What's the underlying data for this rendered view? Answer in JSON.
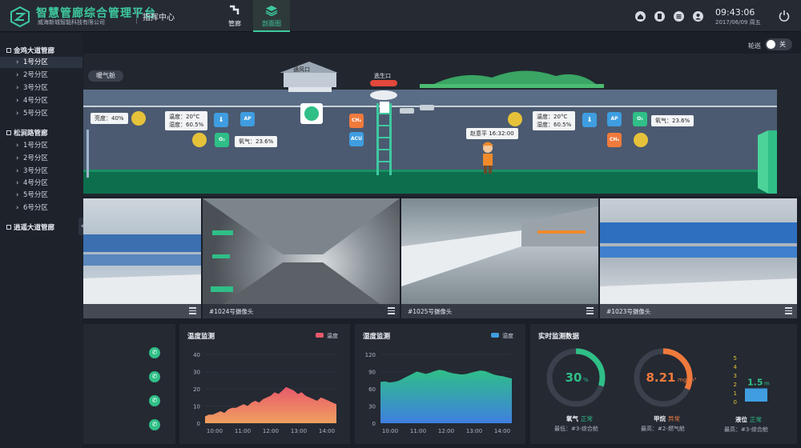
{
  "header": {
    "brand_title": "智慧管廊综合管理平台",
    "brand_subtitle": "威海新城智能科技有限公司",
    "center_label": "指挥中心",
    "nav_tabs": [
      {
        "label": "管廊",
        "icon": "pipe-icon",
        "active": false
      },
      {
        "label": "剖面图",
        "icon": "layers-icon",
        "active": true
      }
    ],
    "icons": [
      "home-icon",
      "document-icon",
      "list-icon",
      "user-icon"
    ],
    "time": "09:43:06",
    "date": "2017/06/09 周五",
    "power_icon": "power-icon"
  },
  "sidebar": {
    "groups": [
      {
        "label": "金鸡大道管廊",
        "items": [
          "1号分区",
          "2号分区",
          "3号分区",
          "4号分区",
          "5号分区"
        ]
      },
      {
        "label": "松涧路管廊",
        "items": [
          "1号分区",
          "2号分区",
          "3号分区",
          "4号分区",
          "5号分区",
          "6号分区"
        ]
      },
      {
        "label": "逍遥大道管廊",
        "items": []
      }
    ],
    "active_item": "1号分区",
    "collapse_glyph": "«"
  },
  "toolbar": {
    "patrol_label": "轮巡",
    "patrol_toggle_state": "关"
  },
  "scene": {
    "room_button": "暖气舱",
    "vent_label": "通风口",
    "escape_label": "逃生口",
    "brightness_tag": "亮度：40%",
    "left_temp": "温度：20°C",
    "left_humidity": "湿度：60.5%",
    "left_oxygen": "氧气：23.6%",
    "right_temp": "温度：20°C",
    "right_humidity": "湿度：60.5%",
    "right_oxygen": "氧气：23.6%",
    "person_tag": "赵意平 16:32:00",
    "sensor_ap": "AP",
    "sensor_ch4": "CH₄",
    "sensor_acu": "ACU",
    "sensor_o2": "O₂"
  },
  "cameras": [
    {
      "label": ""
    },
    {
      "label": "#1024号摄像头"
    },
    {
      "label": "#1025号摄像头"
    },
    {
      "label": "#1023号摄像头"
    }
  ],
  "temp_chart": {
    "title": "温度监测",
    "legend": "温度",
    "color": "#e8596a",
    "y_ticks": [
      "40",
      "30",
      "20",
      "10",
      "0"
    ],
    "x_ticks": [
      "10:00",
      "11:00",
      "12:00",
      "13:00",
      "14:00"
    ]
  },
  "humidity_chart": {
    "title": "湿度监测",
    "legend": "湿度",
    "color": "#3f9de0",
    "y_ticks": [
      "120",
      "90",
      "60",
      "30",
      "0"
    ],
    "x_ticks": [
      "10:00",
      "11:00",
      "12:00",
      "13:00",
      "14:00"
    ]
  },
  "chart_data": [
    {
      "type": "area",
      "title": "温度监测",
      "series": [
        {
          "name": "温度",
          "values": [
            4,
            5,
            5,
            6,
            7,
            6,
            8,
            9,
            9,
            10,
            11,
            10,
            12,
            13,
            12,
            14,
            15,
            16,
            18,
            17,
            19,
            21,
            20,
            19,
            17,
            18,
            16,
            15,
            14,
            13,
            15,
            14,
            13,
            12,
            11
          ]
        }
      ],
      "x": [
        "09:30",
        "14:45"
      ],
      "x_ticks": [
        "10:00",
        "11:00",
        "12:00",
        "13:00",
        "14:00"
      ],
      "ylim": [
        0,
        40
      ]
    },
    {
      "type": "area",
      "title": "湿度监测",
      "series": [
        {
          "name": "湿度",
          "values": [
            72,
            73,
            71,
            72,
            74,
            78,
            82,
            86,
            90,
            88,
            86,
            88,
            91,
            93,
            92,
            89,
            87,
            86,
            85,
            86,
            88,
            90,
            92,
            91,
            88,
            85,
            83,
            82,
            80,
            78
          ]
        }
      ],
      "x": [
        "09:30",
        "14:45"
      ],
      "x_ticks": [
        "10:00",
        "11:00",
        "12:00",
        "13:00",
        "14:00"
      ],
      "ylim": [
        0,
        120
      ]
    }
  ],
  "realtime": {
    "title": "实时监测数据",
    "oxygen": {
      "value": "30",
      "unit": "%",
      "fraction": 0.3,
      "name": "氧气",
      "status": "正常",
      "sub": "最低：#3-综合舱",
      "color": "#2fbf87"
    },
    "methane": {
      "value": "8.21",
      "unit": "mg/m³",
      "fraction": 0.32,
      "name": "甲烷",
      "status": "异常",
      "sub": "最高：#2-燃气舱",
      "color": "#f07a3c"
    },
    "level": {
      "value": "1.5",
      "unit": "m",
      "name": "液位",
      "status": "正常",
      "sub": "最高：#3-综合舱",
      "ticks": [
        "5",
        "4",
        "3",
        "2",
        "1",
        "0"
      ],
      "level": 1.5,
      "max": 5
    }
  },
  "left_panel": {
    "phone_icon": "phone-icon"
  }
}
